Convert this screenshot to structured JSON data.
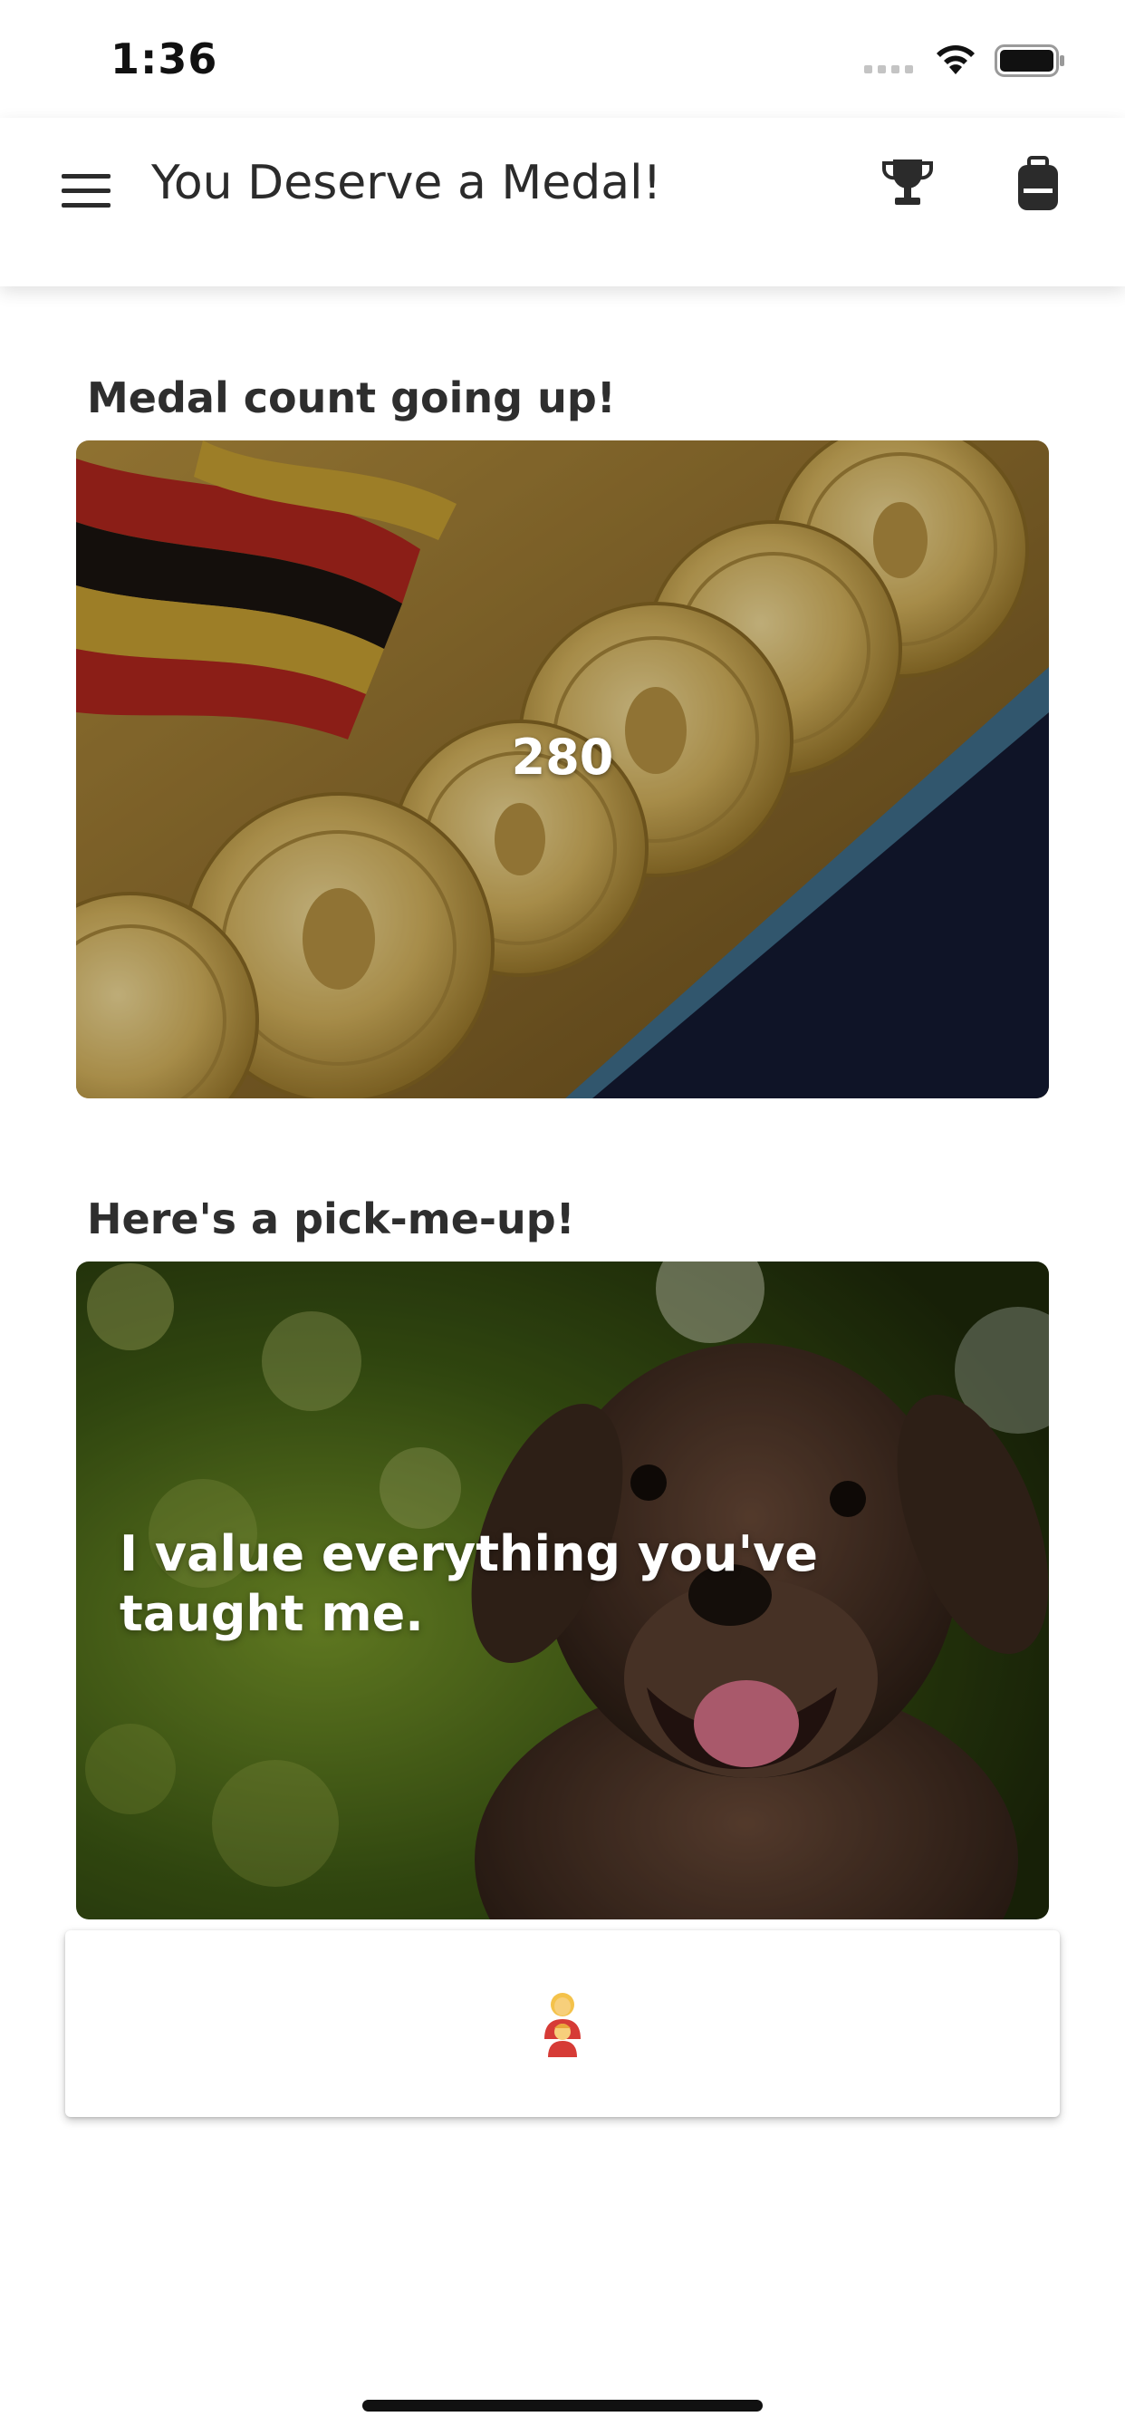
{
  "status_bar": {
    "time": "1:36"
  },
  "app_bar": {
    "title": "You Deserve a Medal!",
    "icons": [
      "menu-icon",
      "trophy-icon",
      "backpack-icon"
    ]
  },
  "medal_section": {
    "heading": "Medal count going up!",
    "count": "280",
    "image": "gold-medals-photo"
  },
  "pickup_section": {
    "heading": "Here's a pick-me-up!",
    "quote": "I value everything you've taught me.",
    "image": "puppy-photo"
  },
  "action_card": {
    "icon": "family-icon"
  },
  "colors": {
    "text_primary": "#2e2e2e",
    "card_text": "#ffffff",
    "background": "#ffffff"
  }
}
